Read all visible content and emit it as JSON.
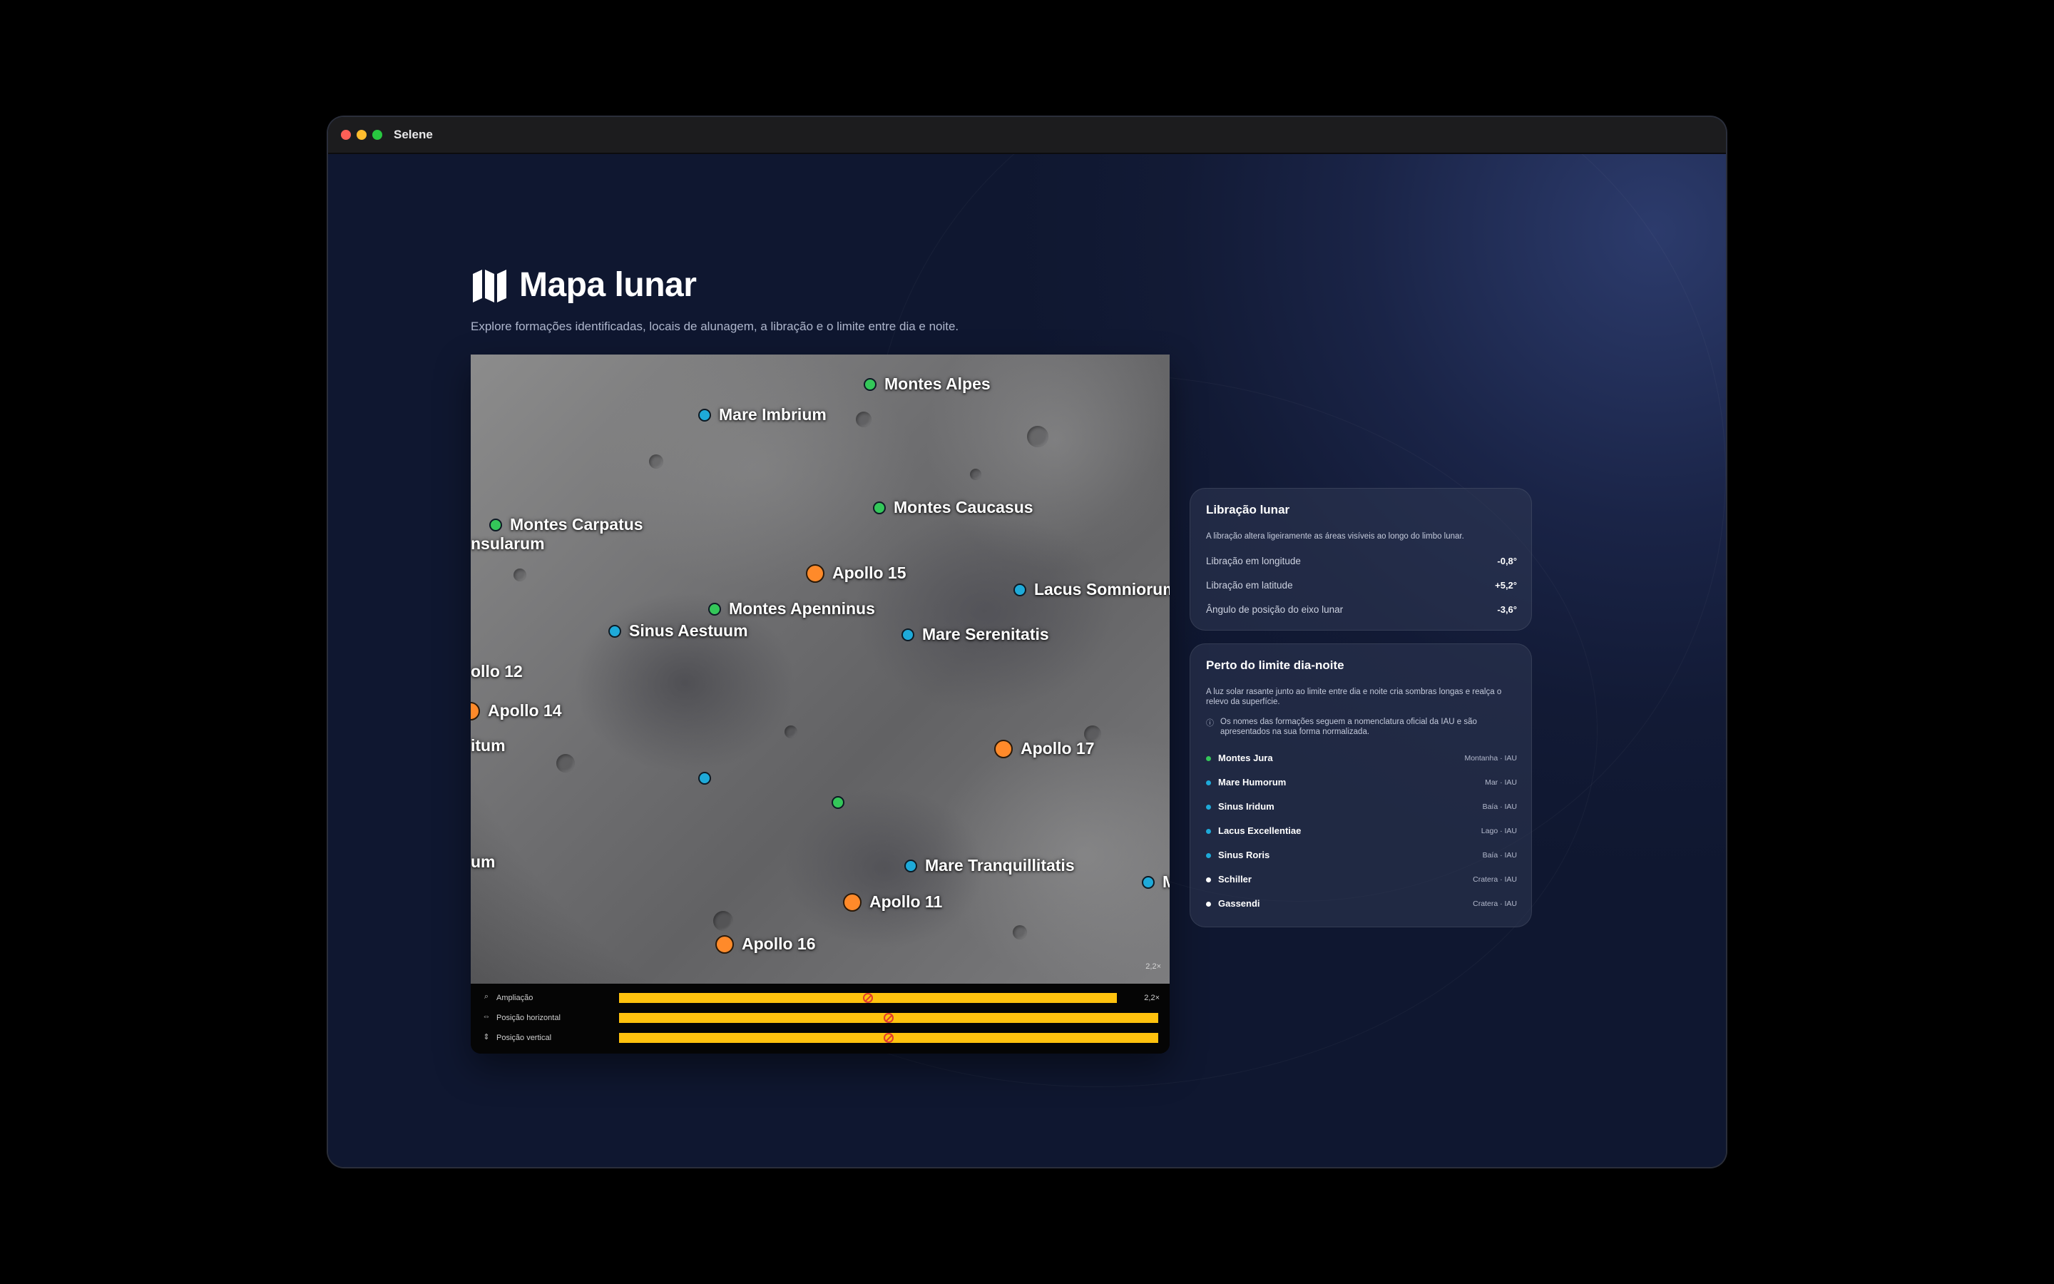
{
  "window": {
    "title": "Selene"
  },
  "header": {
    "title": "Mapa lunar",
    "subtitle": "Explore formações identificadas, locais de alunagem, a libração e o limite entre dia e noite."
  },
  "colors": {
    "mountain": "#34c759",
    "mare": "#1eaad9",
    "landing": "#ff8a2a",
    "crater": "#ffffff",
    "slider": "#ffc20e"
  },
  "map": {
    "markers": [
      {
        "label": "Montes Alpes",
        "kind": "mountain"
      },
      {
        "label": "Mare Imbrium",
        "kind": "mare"
      },
      {
        "label": "Montes Caucasus",
        "kind": "mountain"
      },
      {
        "label": "Montes Carpatus",
        "kind": "mountain"
      },
      {
        "label": "nsularum",
        "kind": "label"
      },
      {
        "label": "Apollo 15",
        "kind": "landing"
      },
      {
        "label": "Lacus Somniorum",
        "kind": "mare"
      },
      {
        "label": "Montes Apenninus",
        "kind": "mountain"
      },
      {
        "label": "Sinus Aestuum",
        "kind": "mare"
      },
      {
        "label": "Mare Serenitatis",
        "kind": "mare"
      },
      {
        "label": "ollo 12",
        "kind": "label"
      },
      {
        "label": "Apollo 14",
        "kind": "landing"
      },
      {
        "label": "Apollo 17",
        "kind": "landing"
      },
      {
        "label": "itum",
        "kind": "label"
      },
      {
        "label": "",
        "kind": "mare"
      },
      {
        "label": "",
        "kind": "mountain"
      },
      {
        "label": "um",
        "kind": "label"
      },
      {
        "label": "Mare Tranquillitatis",
        "kind": "mare"
      },
      {
        "label": "M",
        "kind": "mare"
      },
      {
        "label": "Apollo 11",
        "kind": "landing"
      },
      {
        "label": "Apollo 16",
        "kind": "landing"
      }
    ],
    "zoom_readout": "2,2×",
    "controls": [
      {
        "icon": "magnifier-icon",
        "label": "Ampliação",
        "value_fraction": 0.5,
        "value_text": "2,2×"
      },
      {
        "icon": "horizontal-arrows-icon",
        "label": "Posição horizontal",
        "value_fraction": 0.5,
        "value_text": ""
      },
      {
        "icon": "vertical-arrows-icon",
        "label": "Posição vertical",
        "value_fraction": 0.5,
        "value_text": ""
      }
    ]
  },
  "libration": {
    "title": "Libração lunar",
    "description": "A libração altera ligeiramente as áreas visíveis ao longo do limbo lunar.",
    "rows": [
      {
        "key": "Libração em longitude",
        "value": "-0,8°"
      },
      {
        "key": "Libração em latitude",
        "value": "+5,2°"
      },
      {
        "key": "Ângulo de posição do eixo lunar",
        "value": "-3,6°"
      }
    ]
  },
  "terminator": {
    "title": "Perto do limite dia-noite",
    "description": "A luz solar rasante junto ao limite entre dia e noite cria sombras longas e realça o relevo da superfície.",
    "note": "Os nomes das formações seguem a nomenclatura oficial da IAU e são apresentados na sua forma normalizada.",
    "features": [
      {
        "name": "Montes Jura",
        "type": "Montanha · IAU",
        "kind": "mountain"
      },
      {
        "name": "Mare Humorum",
        "type": "Mar · IAU",
        "kind": "mare"
      },
      {
        "name": "Sinus Iridum",
        "type": "Baía · IAU",
        "kind": "mare"
      },
      {
        "name": "Lacus Excellentiae",
        "type": "Lago · IAU",
        "kind": "mare"
      },
      {
        "name": "Sinus Roris",
        "type": "Baía · IAU",
        "kind": "mare"
      },
      {
        "name": "Schiller",
        "type": "Cratera · IAU",
        "kind": "crater"
      },
      {
        "name": "Gassendi",
        "type": "Cratera · IAU",
        "kind": "crater"
      }
    ]
  }
}
